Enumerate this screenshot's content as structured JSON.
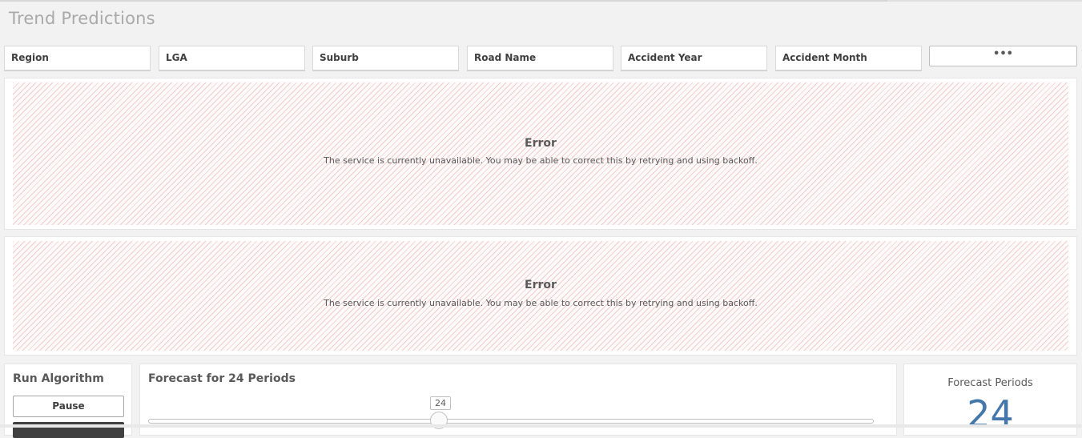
{
  "sheet": {
    "title": "Trend Predictions"
  },
  "filters": [
    "Region",
    "LGA",
    "Suburb",
    "Road Name",
    "Accident Year",
    "Accident Month"
  ],
  "more_button": {
    "label": "•••"
  },
  "errors": [
    {
      "title": "Error",
      "message": "The service is currently unavailable. You may be able to correct this by retrying and using backoff."
    },
    {
      "title": "Error",
      "message": "The service is currently unavailable. You may be able to correct this by retrying and using backoff."
    }
  ],
  "run_algorithm": {
    "title": "Run Algorithm",
    "pause_label": "Pause"
  },
  "forecast_slider": {
    "title": "Forecast for 24 Periods",
    "value": "24"
  },
  "kpi": {
    "label": "Forecast Periods",
    "value": "24",
    "color": "#4477aa"
  },
  "colors": {
    "error_stripe": "#f5cccc",
    "background": "#f2f2f2"
  }
}
